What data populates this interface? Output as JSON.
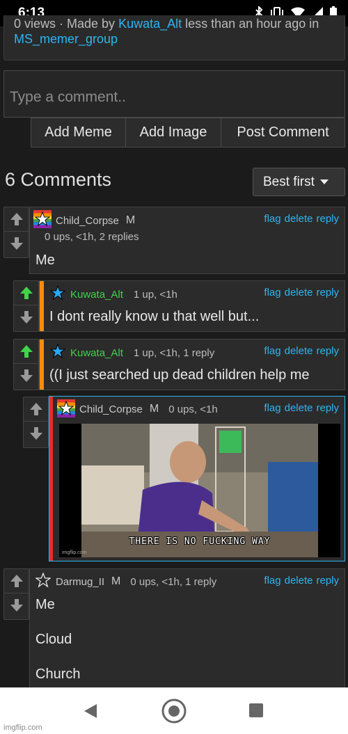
{
  "status_bar": {
    "time": "6:13",
    "icons": [
      "bluetooth-icon",
      "vibrate-icon",
      "wifi-icon",
      "signal-icon",
      "battery-icon"
    ]
  },
  "post_meta": {
    "views_prefix": "0 views · Made by ",
    "author": "Kuwata_Alt",
    "middle": " less than an hour ago in",
    "group": "MS_memer_group"
  },
  "comment_box": {
    "placeholder": "Type a comment.."
  },
  "buttons": {
    "add_meme": "Add Meme",
    "add_image": "Add Image",
    "post_comment": "Post Comment"
  },
  "comments_header": {
    "count_label": "6 Comments",
    "sort_label": "Best first"
  },
  "actions": {
    "flag": "flag",
    "delete": "delete",
    "reply": "reply"
  },
  "comments": [
    {
      "user": "Child_Corpse",
      "badge": "M",
      "meta": "0 ups, <1h, 2 replies",
      "text": "Me"
    },
    {
      "user": "Kuwata_Alt",
      "meta": "1 up, <1h",
      "text": "I dont really know u that well but..."
    },
    {
      "user": "Kuwata_Alt",
      "meta": "1 up, <1h, 1 reply",
      "text": "((I just searched up dead children help me"
    },
    {
      "user": "Child_Corpse",
      "badge": "M",
      "meta": "0 ups, <1h",
      "meme_caption": "THERE IS NO FUCKING WAY",
      "meme_watermark": "imgflip.com"
    },
    {
      "user": "Darmug_II",
      "badge": "M",
      "meta": "0 ups, <1h, 1 reply",
      "lines": [
        "Me",
        "Cloud",
        "Church"
      ]
    }
  ],
  "watermark": "imgflip.com",
  "colors": {
    "link": "#2cb6f2",
    "upvote_active": "#3fd44a",
    "reply_bar_orange": "#ff8c00",
    "reply_bar_red": "#e0302f",
    "highlight_border": "#2cb6f2"
  }
}
